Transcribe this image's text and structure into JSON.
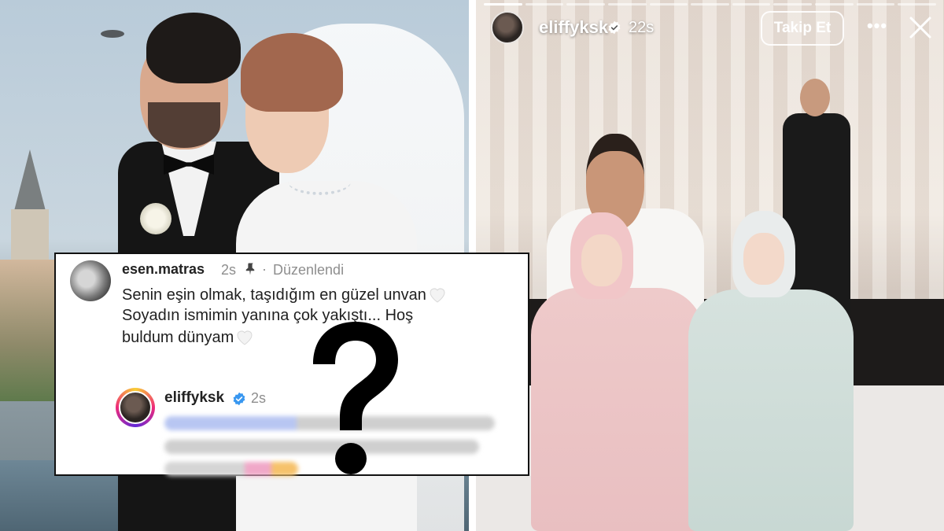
{
  "left_photo": {
    "alt": ""
  },
  "story": {
    "username": "eliffyksk",
    "time": "22s",
    "follow_label": "Takip Et",
    "more_label": "•••",
    "progress_segments": 11,
    "active_segment": 0,
    "verified_color": "#3897f0"
  },
  "comment": {
    "username": "esen.matras",
    "time": "2s",
    "dot": "·",
    "edited_label": "Düzenlendi",
    "lines": [
      "Senin eşin olmak, taşıdığım en güzel unvan",
      "Soyadın ismimin yanına çok yakıştı... Hoş",
      "buldum dünyam"
    ],
    "heart_icon": "white-heart-emoji"
  },
  "reply": {
    "username": "eliffyksk",
    "time": "2s",
    "content_state": "blurred",
    "verified_color": "#3897f0",
    "ring_colors": [
      "#f9ce34",
      "#ee2a7b",
      "#6228d7"
    ]
  },
  "overlay": {
    "symbol": "question-mark",
    "color": "#000000"
  },
  "icons": {
    "close": "close-icon",
    "pin": "pin-icon",
    "verified": "verified-badge-icon"
  }
}
